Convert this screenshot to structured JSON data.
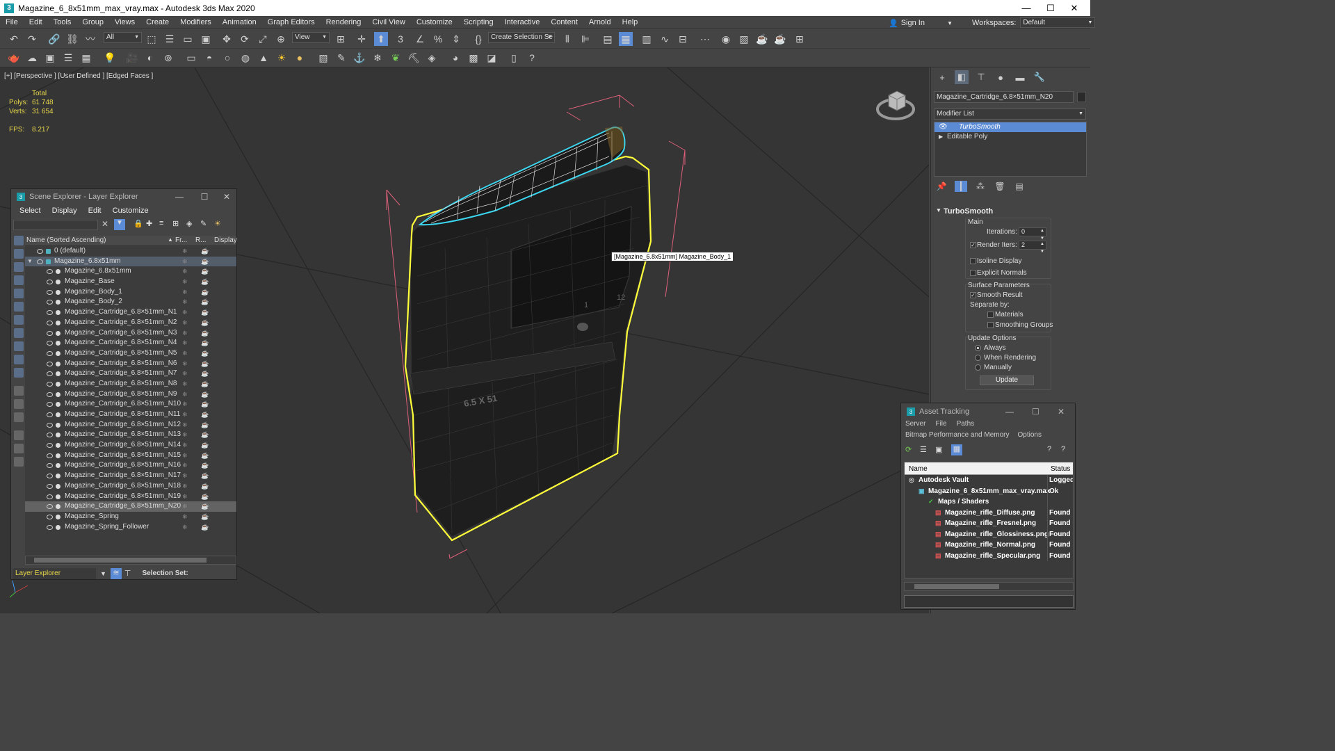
{
  "window": {
    "title": "Magazine_6_8x51mm_max_vray.max - Autodesk 3ds Max 2020",
    "app_icon": "3",
    "minimize": "—",
    "maximize": "☐",
    "close": "✕"
  },
  "menu": [
    "File",
    "Edit",
    "Tools",
    "Group",
    "Views",
    "Create",
    "Modifiers",
    "Animation",
    "Graph Editors",
    "Rendering",
    "Civil View",
    "Customize",
    "Scripting",
    "Interactive",
    "Content",
    "Arnold",
    "Help"
  ],
  "signin": {
    "label": "Sign In"
  },
  "workspaces": {
    "label": "Workspaces:",
    "value": "Default"
  },
  "toolbar": {
    "filter": "All",
    "coord": "View",
    "selection_set": "Create Selection Se"
  },
  "viewport": {
    "label": "[+] [Perspective ] [User Defined ] [Edged Faces ]",
    "stats": {
      "header": "Total",
      "polys_label": "Polys:",
      "polys": "61 748",
      "verts_label": "Verts:",
      "verts": "31 654",
      "fps_label": "FPS:",
      "fps": "8.217"
    },
    "tooltip": "[Magazine_6.8x51mm] Magazine_Body_1",
    "model_labels": {
      "caliber": "6.5 X 51",
      "num1": "1",
      "num2": "12"
    }
  },
  "command_panel": {
    "object_name": "Magazine_Cartridge_6.8×51mm_N20",
    "modifier_list": "Modifier List",
    "stack": [
      "TurboSmooth",
      "Editable Poly"
    ],
    "turbosmooth": {
      "title": "TurboSmooth",
      "main_label": "Main",
      "iterations_label": "Iterations:",
      "iterations": "0",
      "render_iters_label": "Render Iters:",
      "render_iters": "2",
      "isoline": "Isoline Display",
      "explicit_normals": "Explicit Normals",
      "surface_params": "Surface Parameters",
      "smooth_result": "Smooth Result",
      "separate_by": "Separate by:",
      "materials": "Materials",
      "smoothing_groups": "Smoothing Groups",
      "update_options": "Update Options",
      "always": "Always",
      "when_rendering": "When Rendering",
      "manually": "Manually",
      "update_btn": "Update"
    }
  },
  "scene_explorer": {
    "title": "Scene Explorer - Layer Explorer",
    "menu": [
      "Select",
      "Display",
      "Edit",
      "Customize"
    ],
    "columns": {
      "name": "Name (Sorted Ascending)",
      "frozen": "Fr...",
      "render": "R...",
      "display": "Display"
    },
    "rows": [
      {
        "name": "0 (default)",
        "level": 1
      },
      {
        "name": "Magazine_6.8x51mm",
        "level": 1
      },
      {
        "name": "Magazine_6.8x51mm",
        "level": 2
      },
      {
        "name": "Magazine_Base",
        "level": 2
      },
      {
        "name": "Magazine_Body_1",
        "level": 2
      },
      {
        "name": "Magazine_Body_2",
        "level": 2
      },
      {
        "name": "Magazine_Cartridge_6.8×51mm_N1",
        "level": 2
      },
      {
        "name": "Magazine_Cartridge_6.8×51mm_N2",
        "level": 2
      },
      {
        "name": "Magazine_Cartridge_6.8×51mm_N3",
        "level": 2
      },
      {
        "name": "Magazine_Cartridge_6.8×51mm_N4",
        "level": 2
      },
      {
        "name": "Magazine_Cartridge_6.8×51mm_N5",
        "level": 2
      },
      {
        "name": "Magazine_Cartridge_6.8×51mm_N6",
        "level": 2
      },
      {
        "name": "Magazine_Cartridge_6.8×51mm_N7",
        "level": 2
      },
      {
        "name": "Magazine_Cartridge_6.8×51mm_N8",
        "level": 2
      },
      {
        "name": "Magazine_Cartridge_6.8×51mm_N9",
        "level": 2
      },
      {
        "name": "Magazine_Cartridge_6.8×51mm_N10",
        "level": 2
      },
      {
        "name": "Magazine_Cartridge_6.8×51mm_N11",
        "level": 2
      },
      {
        "name": "Magazine_Cartridge_6.8×51mm_N12",
        "level": 2
      },
      {
        "name": "Magazine_Cartridge_6.8×51mm_N13",
        "level": 2
      },
      {
        "name": "Magazine_Cartridge_6.8×51mm_N14",
        "level": 2
      },
      {
        "name": "Magazine_Cartridge_6.8×51mm_N15",
        "level": 2
      },
      {
        "name": "Magazine_Cartridge_6.8×51mm_N16",
        "level": 2
      },
      {
        "name": "Magazine_Cartridge_6.8×51mm_N17",
        "level": 2
      },
      {
        "name": "Magazine_Cartridge_6.8×51mm_N18",
        "level": 2
      },
      {
        "name": "Magazine_Cartridge_6.8×51mm_N19",
        "level": 2
      },
      {
        "name": "Magazine_Cartridge_6.8×51mm_N20",
        "level": 2
      },
      {
        "name": "Magazine_Spring",
        "level": 2
      },
      {
        "name": "Magazine_Spring_Follower",
        "level": 2
      }
    ],
    "bottom": {
      "explorer": "Layer Explorer",
      "selection_set": "Selection Set:"
    }
  },
  "asset_tracking": {
    "title": "Asset Tracking",
    "menu1": [
      "Server",
      "File",
      "Paths"
    ],
    "menu2": [
      "Bitmap Performance and Memory",
      "Options"
    ],
    "columns": {
      "name": "Name",
      "status": "Status"
    },
    "rows": [
      {
        "name": "Autodesk Vault",
        "status": "Logged"
      },
      {
        "name": "Magazine_6_8x51mm_max_vray.max",
        "status": "Ok"
      },
      {
        "name": "Maps / Shaders",
        "status": ""
      },
      {
        "name": "Magazine_rifle_Diffuse.png",
        "status": "Found"
      },
      {
        "name": "Magazine_rifle_Fresnel.png",
        "status": "Found"
      },
      {
        "name": "Magazine_rifle_Glossiness.png",
        "status": "Found"
      },
      {
        "name": "Magazine_rifle_Normal.png",
        "status": "Found"
      },
      {
        "name": "Magazine_rifle_Specular.png",
        "status": "Found"
      }
    ]
  },
  "colors": {
    "selection_yellow": "#ffff3a",
    "selection_cyan": "#3cd7f0",
    "bbox_pink": "#e0607a",
    "stats_yellow": "#e8d84a",
    "stack_selected": "#5c8bd6"
  }
}
